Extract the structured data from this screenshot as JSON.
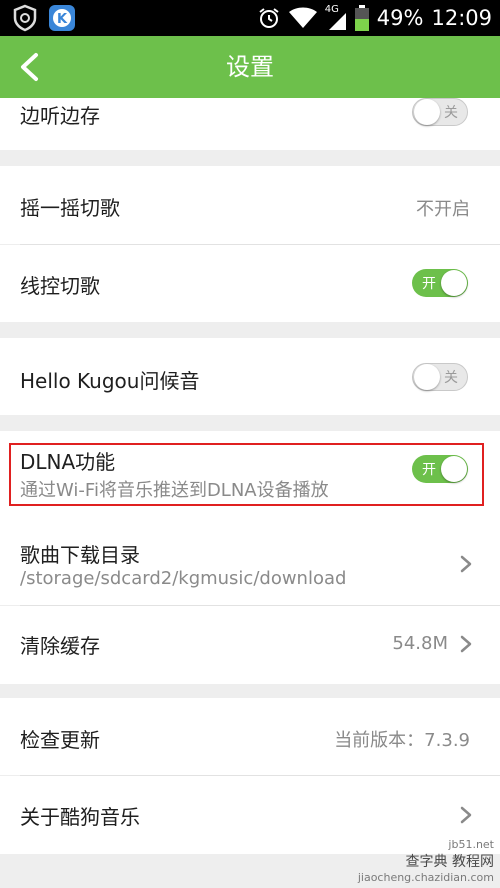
{
  "status_bar": {
    "icons": [
      "shield-icon",
      "kugou-app-icon",
      "alarm-icon",
      "wifi-icon",
      "cellular-4g-icon",
      "battery-icon"
    ],
    "network": "4G",
    "battery": "49%",
    "time": "12:09"
  },
  "app_bar": {
    "back_icon": "chevron-left-icon",
    "title": "设置"
  },
  "settings": {
    "listen_save": {
      "label": "边听边存",
      "toggle": "关",
      "state": "off"
    },
    "shake": {
      "label": "摇一摇切歌",
      "value": "不开启"
    },
    "wire_control": {
      "label": "线控切歌",
      "toggle": "开",
      "state": "on"
    },
    "hello_kugou": {
      "label": "Hello Kugou问候音",
      "toggle": "关",
      "state": "off"
    },
    "dlna": {
      "label": "DLNA功能",
      "desc": "通过Wi-Fi将音乐推送到DLNA设备播放",
      "toggle": "开",
      "state": "on"
    },
    "download_dir": {
      "label": "歌曲下载目录",
      "path": "/storage/sdcard2/kgmusic/download"
    },
    "clear_cache": {
      "label": "清除缓存",
      "value": "54.8M"
    },
    "check_update": {
      "label": "检查更新",
      "value": "当前版本：7.3.9"
    },
    "about": {
      "label": "关于酷狗音乐"
    }
  },
  "watermark": {
    "line1": "查字典 教程网",
    "line2": "jiaocheng.chazidian.com",
    "corner": "jb51.net"
  },
  "colors": {
    "accent": "#6dc04b",
    "highlight": "#e02020"
  }
}
